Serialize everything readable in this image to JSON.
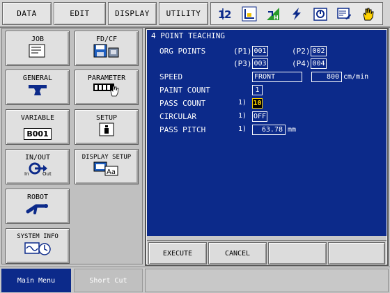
{
  "menubar": {
    "data": "DATA",
    "edit": "EDIT",
    "display": "DISPLAY",
    "utility": "UTILITY"
  },
  "toolbar_icons": [
    "job-number-icon",
    "coordinate-icon",
    "interference-icon",
    "servo-icon",
    "monitor-icon",
    "edit-screen-icon",
    "hand-icon"
  ],
  "main_menu": {
    "job": "JOB",
    "fdcf": "FD/CF",
    "general": "GENERAL",
    "parameter": "PARAMETER",
    "variable": "VARIABLE",
    "variable_value": "B001",
    "setup": "SETUP",
    "inout": "IN/OUT",
    "display_setup": "DISPLAY SETUP",
    "robot": "ROBOT",
    "system_info": "SYSTEM INFO"
  },
  "panel": {
    "title": "4 POINT TEACHING",
    "org_points_label": "ORG POINTS",
    "p1_label": "(P1)",
    "p1_value": "001",
    "p2_label": "(P2)",
    "p2_value": "002",
    "p3_label": "(P3)",
    "p3_value": "003",
    "p4_label": "(P4)",
    "p4_value": "004",
    "speed_label": "SPEED",
    "speed_mode": "FRONT",
    "speed_value": "800",
    "speed_unit": "cm/min",
    "paint_count_label": "PAINT COUNT",
    "paint_count_value": "1",
    "pass_count_label": "PASS COUNT",
    "pass_count_index": "1)",
    "pass_count_value": "10",
    "circular_label": "CIRCULAR",
    "circular_index": "1)",
    "circular_value": "OFF",
    "pass_pitch_label": "PASS PITCH",
    "pass_pitch_index": "1)",
    "pass_pitch_value": "63.78",
    "pass_pitch_unit": "mm"
  },
  "actions": {
    "execute": "EXECUTE",
    "cancel": "CANCEL"
  },
  "bottom": {
    "main_menu": "Main Menu",
    "short_cut": "Short Cut"
  },
  "colors": {
    "panel_bg": "#0c2a8a",
    "highlight": "#ffd200"
  }
}
